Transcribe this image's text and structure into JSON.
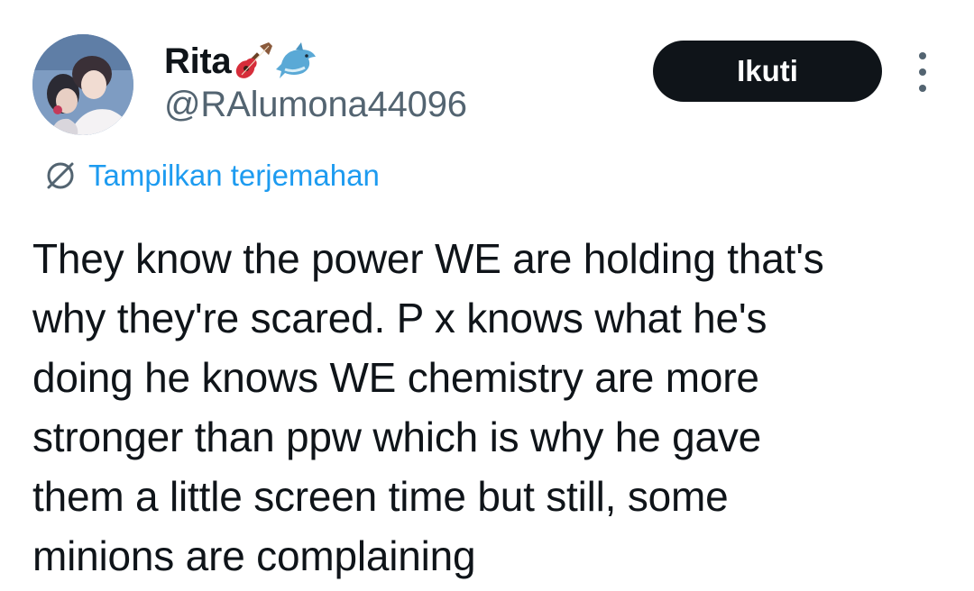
{
  "author": {
    "display_name": "Rita",
    "name_emojis": [
      "guitar-emoji",
      "dolphin-emoji"
    ],
    "handle": "@RAlumona44096"
  },
  "actions": {
    "follow_label": "Ikuti",
    "more_icon": "more-vertical-icon"
  },
  "translate": {
    "icon": "globe-icon",
    "label": "Tampilkan terjemahan",
    "color": "#1d9bf0"
  },
  "tweet": {
    "text": "They know the power WE are holding that's\nwhy they're scared. P x knows what he's\ndoing he knows WE chemistry are more\nstronger than ppw which is why he gave\nthem a little screen time but still, some\nminions are complaining"
  },
  "colors": {
    "text_primary": "#0f1419",
    "text_secondary": "#536471",
    "button_bg": "#0f1419",
    "background": "#ffffff"
  }
}
